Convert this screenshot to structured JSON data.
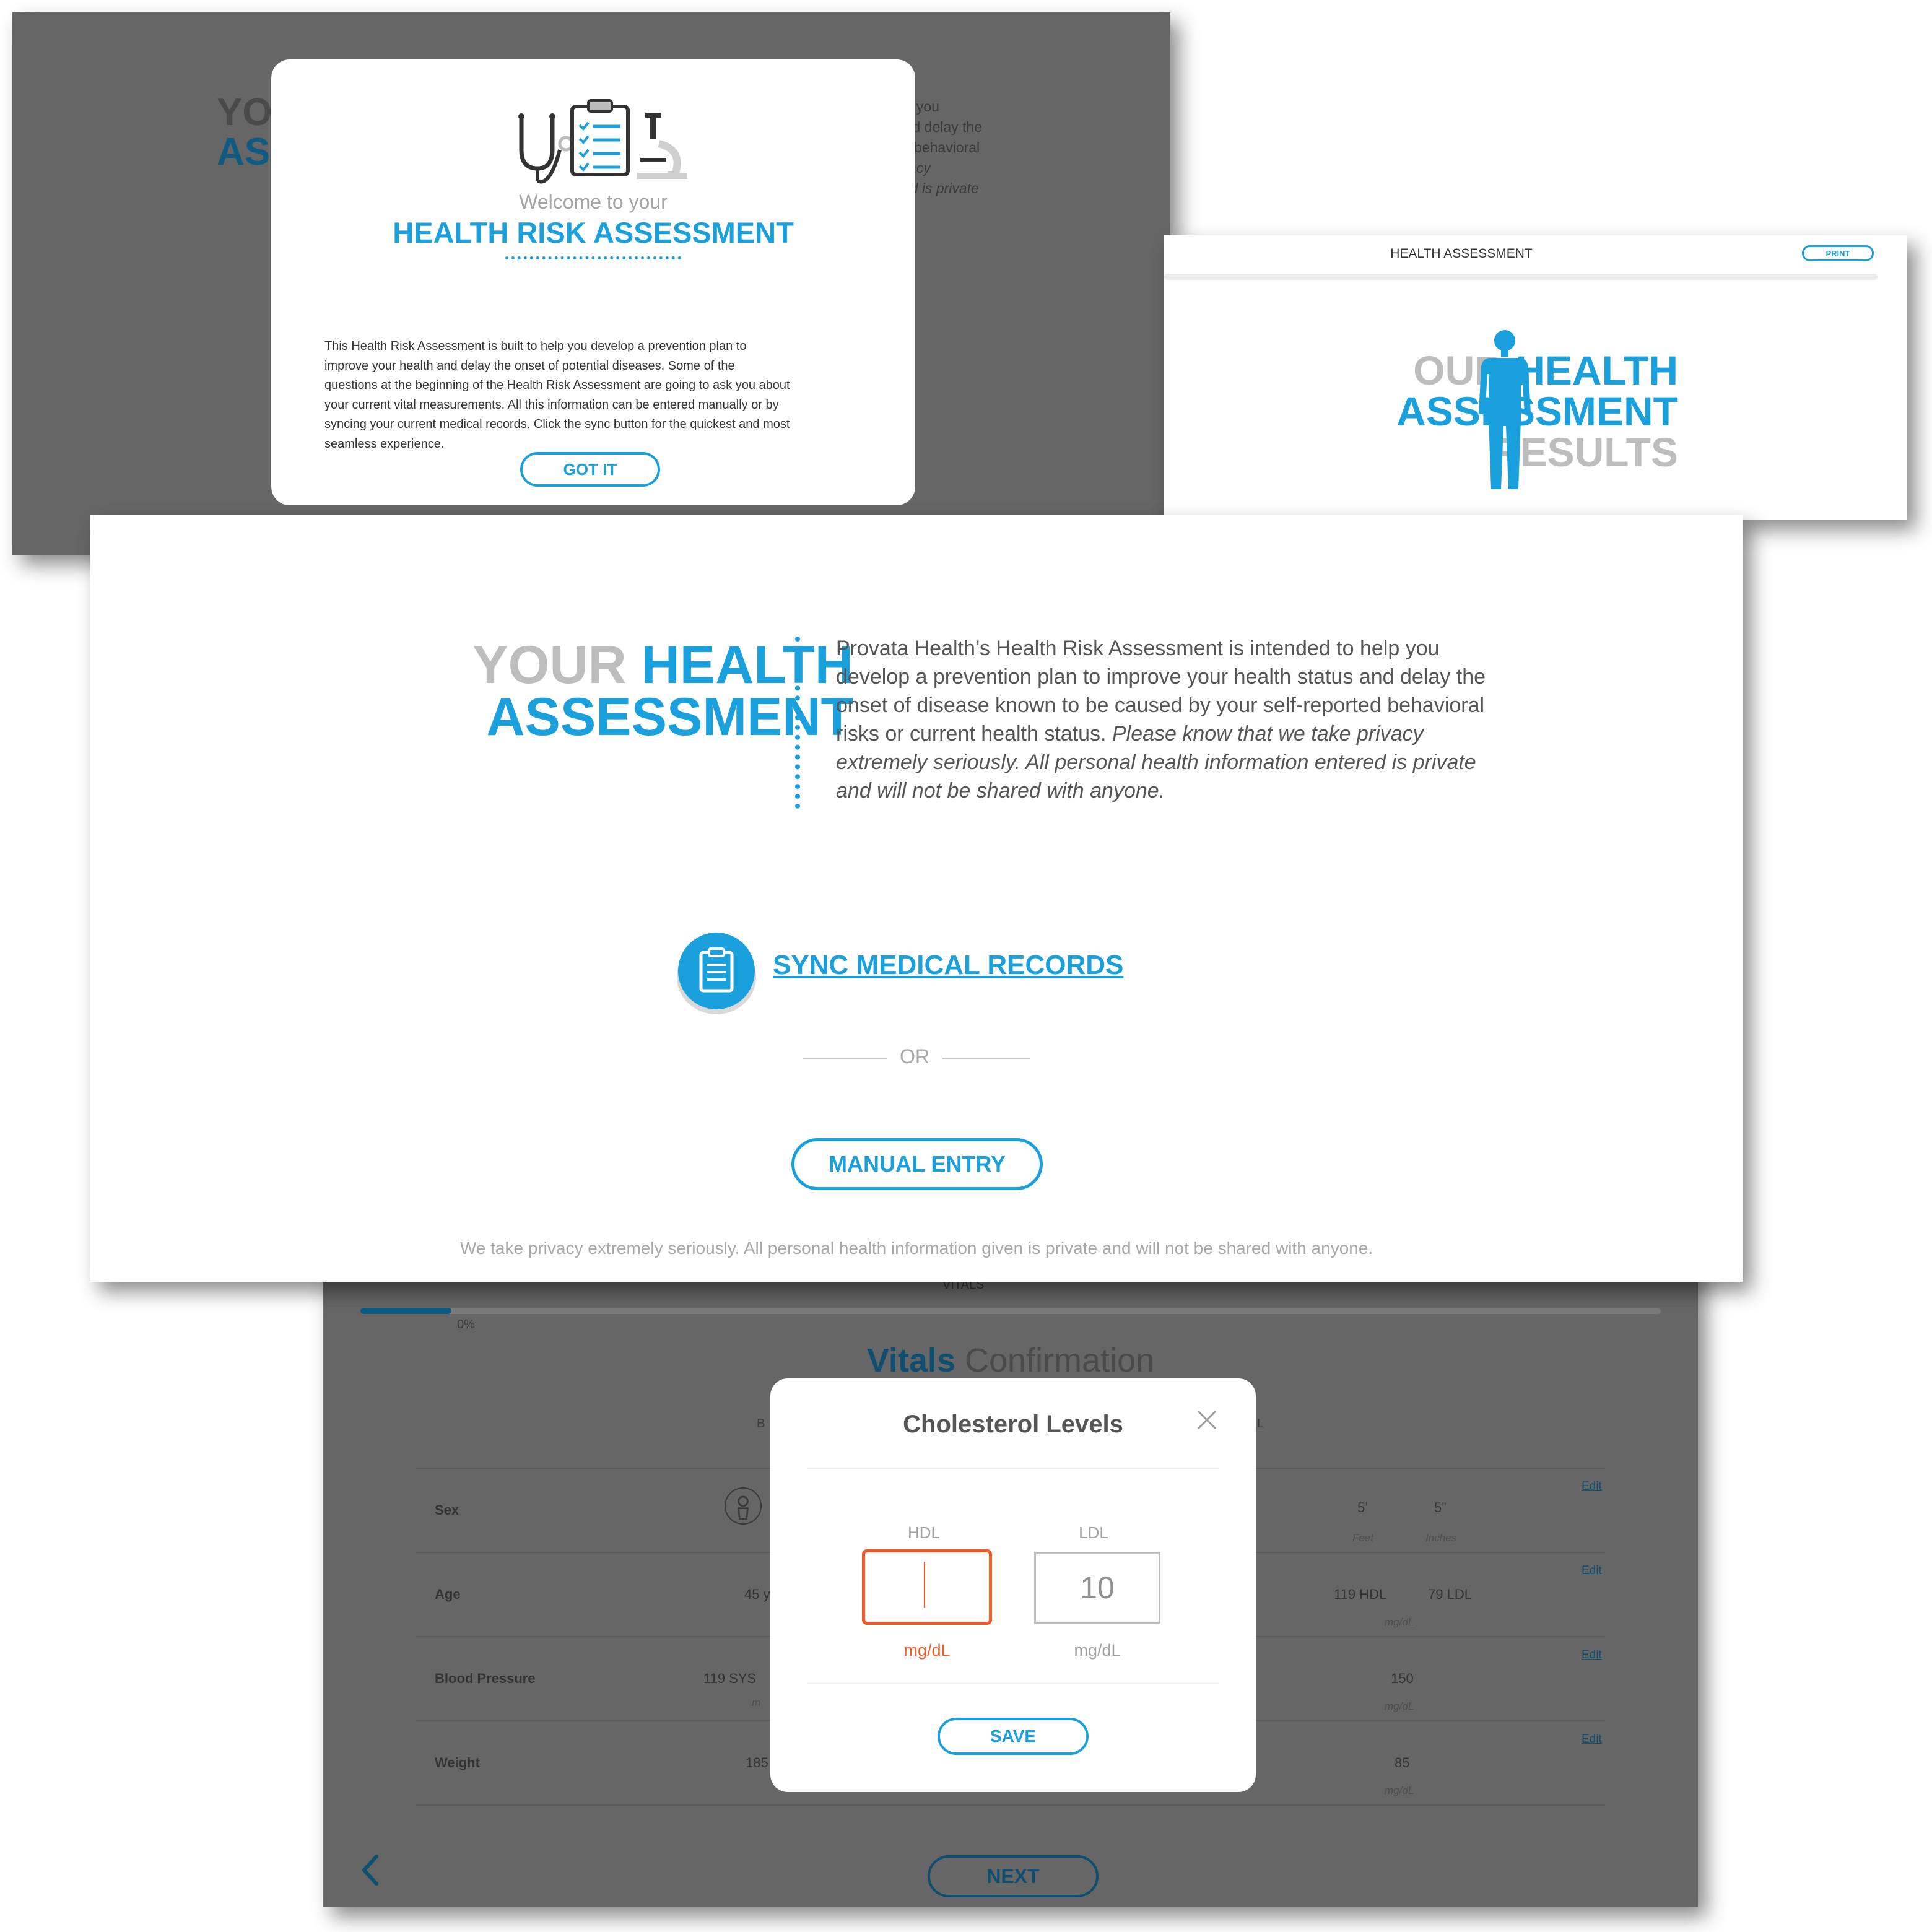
{
  "colors": {
    "accent": "#1aa0dc",
    "dark_accent": "#0e4e70",
    "error": "#f05a28",
    "overlay": "#666666"
  },
  "welcome_screen": {
    "background_title_line1": "YO",
    "background_title_line2": "AS",
    "background_text_line1": "help you",
    "background_text_line2": "s and delay the",
    "background_text_line3": "rted behavioral",
    "background_text_line4": "privacy",
    "background_text_line5": "tered is private",
    "modal": {
      "welcome": "Welcome to your",
      "title": "HEALTH RISK ASSESSMENT",
      "body_line1": "This Health Risk Assessment is built to help you develop a prevention plan to",
      "body_line2": "improve your health and delay the onset of potential diseases. Some of the",
      "body_line3": "questions at the beginning of the Health Risk Assessment are going to ask you about",
      "body_line4": "your current vital measurements. All this information can be entered manually or by",
      "body_line5": "syncing your current medical records. Click the sync button for the quickest and most",
      "body_line6": "seamless experience.",
      "button": "GOT IT",
      "icons": [
        "stethoscope-icon",
        "clipboard-checklist-icon",
        "microscope-icon"
      ]
    }
  },
  "results_screen": {
    "header": "HEALTH ASSESSMENT",
    "print_button": "PRINT",
    "title_line1_a": "OUR",
    "title_line1_b": "HEALTH",
    "title_line2": "ASSESSMENT",
    "title_line3": "RESULTS",
    "figure_icon": "human-body-icon"
  },
  "main_screen": {
    "title_your": "YOUR",
    "title_health": "HEALTH",
    "title_assessment": "ASSESSMENT",
    "intro_line1": "Provata Health’s Health Risk Assessment is intended to help you",
    "intro_line2": "develop a prevention plan to improve your health status and delay the",
    "intro_line3": "onset of disease known to be caused by your self-reported behavioral",
    "intro_line4_normal": "risks or current health status.",
    "intro_line4_italic": "Please know that we take privacy",
    "intro_line5": "extremely seriously. All personal health information entered is private",
    "intro_line6": "and will not be shared with anyone.",
    "sync_icon": "clipboard-icon",
    "sync_link": "SYNC MEDICAL RECORDS",
    "or": "OR",
    "manual_button": "MANUAL ENTRY",
    "privacy_note": "We take privacy extremely seriously. All personal health information given is private and will not be shared with anyone."
  },
  "vitals_screen": {
    "section_label": "VITALS",
    "progress_label": "0%",
    "progress_fraction": 0.07,
    "title_a": "Vitals",
    "title_b": "Confirmation",
    "col_hint_left": "B",
    "col_hint_right": "L",
    "rows": [
      {
        "label": "Sex",
        "edit": "Edit"
      },
      {
        "label": "Age",
        "left_value": "45 y",
        "edit": "Edit"
      },
      {
        "label": "Blood Pressure",
        "left_value": "119 SYS",
        "left_sub": "m",
        "edit": "Edit"
      },
      {
        "label": "Weight",
        "left_value": "185",
        "edit": "Edit"
      }
    ],
    "right_values": {
      "height_feet": "5’",
      "height_feet_unit": "Feet",
      "height_inches": "5”",
      "height_inches_unit": "Inches",
      "hdl": "119 HDL",
      "ldl": "79 LDL",
      "chol_unit": "mg/dL",
      "glucose": "150",
      "glucose_unit": "mg/dL",
      "bmi": "85",
      "bmi_unit": "mg/dL"
    },
    "next_button": "NEXT",
    "modal": {
      "title": "Cholesterol Levels",
      "hdl_label": "HDL",
      "hdl_value": "",
      "hdl_unit": "mg/dL",
      "ldl_label": "LDL",
      "ldl_value": "10",
      "ldl_unit": "mg/dL",
      "save_button": "SAVE"
    }
  }
}
